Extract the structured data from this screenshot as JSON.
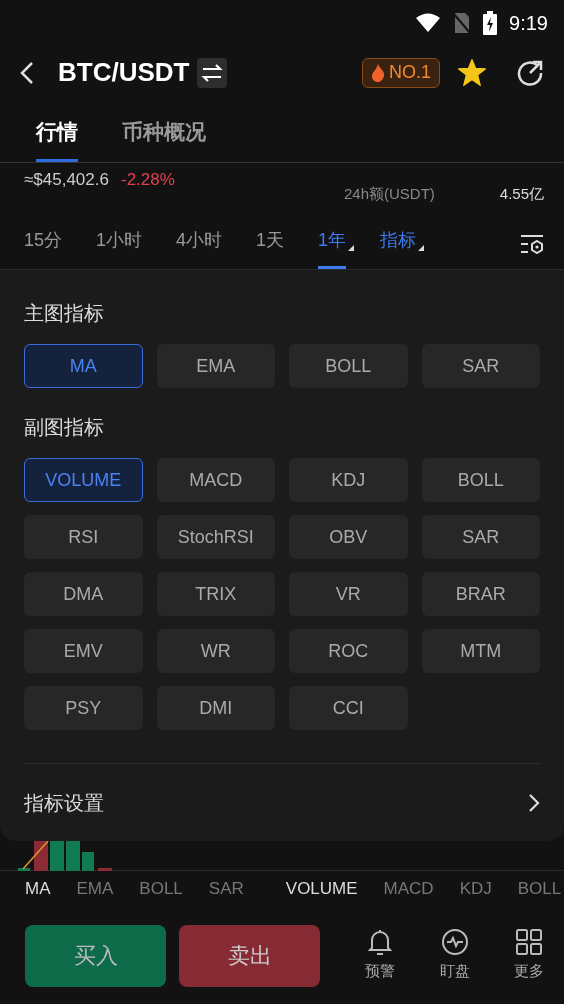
{
  "status_bar": {
    "time": "9:19"
  },
  "header": {
    "title": "BTC/USDT",
    "badge": "NO.1",
    "favorite": true
  },
  "tabs": [
    {
      "label": "行情",
      "selected": true
    },
    {
      "label": "币种概况",
      "selected": false
    }
  ],
  "stats": {
    "price": "≈$45,402.6",
    "change": "-2.28%",
    "volume_label": "24h额(USDT)",
    "volume_value": "4.55亿"
  },
  "timeframes": [
    {
      "label": "15分",
      "selected": false,
      "dropdown": false
    },
    {
      "label": "1小时",
      "selected": false,
      "dropdown": false
    },
    {
      "label": "4小时",
      "selected": false,
      "dropdown": false
    },
    {
      "label": "1天",
      "selected": false,
      "dropdown": false
    },
    {
      "label": "1年",
      "selected": true,
      "dropdown": true
    }
  ],
  "indicator_menu": {
    "label": "指标"
  },
  "indicator_panel": {
    "sections": [
      {
        "title": "主图指标",
        "options": [
          {
            "label": "MA",
            "selected": true
          },
          {
            "label": "EMA",
            "selected": false
          },
          {
            "label": "BOLL",
            "selected": false
          },
          {
            "label": "SAR",
            "selected": false
          }
        ]
      },
      {
        "title": "副图指标",
        "options": [
          {
            "label": "VOLUME",
            "selected": true
          },
          {
            "label": "MACD",
            "selected": false
          },
          {
            "label": "KDJ",
            "selected": false
          },
          {
            "label": "BOLL",
            "selected": false
          },
          {
            "label": "RSI",
            "selected": false
          },
          {
            "label": "StochRSI",
            "selected": false
          },
          {
            "label": "OBV",
            "selected": false
          },
          {
            "label": "SAR",
            "selected": false
          },
          {
            "label": "DMA",
            "selected": false
          },
          {
            "label": "TRIX",
            "selected": false
          },
          {
            "label": "VR",
            "selected": false
          },
          {
            "label": "BRAR",
            "selected": false
          },
          {
            "label": "EMV",
            "selected": false
          },
          {
            "label": "WR",
            "selected": false
          },
          {
            "label": "ROC",
            "selected": false
          },
          {
            "label": "MTM",
            "selected": false
          },
          {
            "label": "PSY",
            "selected": false
          },
          {
            "label": "DMI",
            "selected": false
          },
          {
            "label": "CCI",
            "selected": false
          }
        ]
      }
    ],
    "settings_label": "指标设置"
  },
  "indicator_strip": {
    "main": [
      {
        "label": "MA",
        "selected": true
      },
      {
        "label": "EMA",
        "selected": false
      },
      {
        "label": "BOLL",
        "selected": false
      },
      {
        "label": "SAR",
        "selected": false
      }
    ],
    "sub": [
      {
        "label": "VOLUME",
        "selected": true
      },
      {
        "label": "MACD",
        "selected": false
      },
      {
        "label": "KDJ",
        "selected": false
      },
      {
        "label": "BOLL",
        "selected": false
      }
    ]
  },
  "bottom_bar": {
    "buy": "买入",
    "sell": "卖出",
    "actions": [
      {
        "kind": "alert",
        "label": "预警"
      },
      {
        "kind": "watch",
        "label": "盯盘"
      },
      {
        "kind": "more",
        "label": "更多"
      }
    ]
  }
}
